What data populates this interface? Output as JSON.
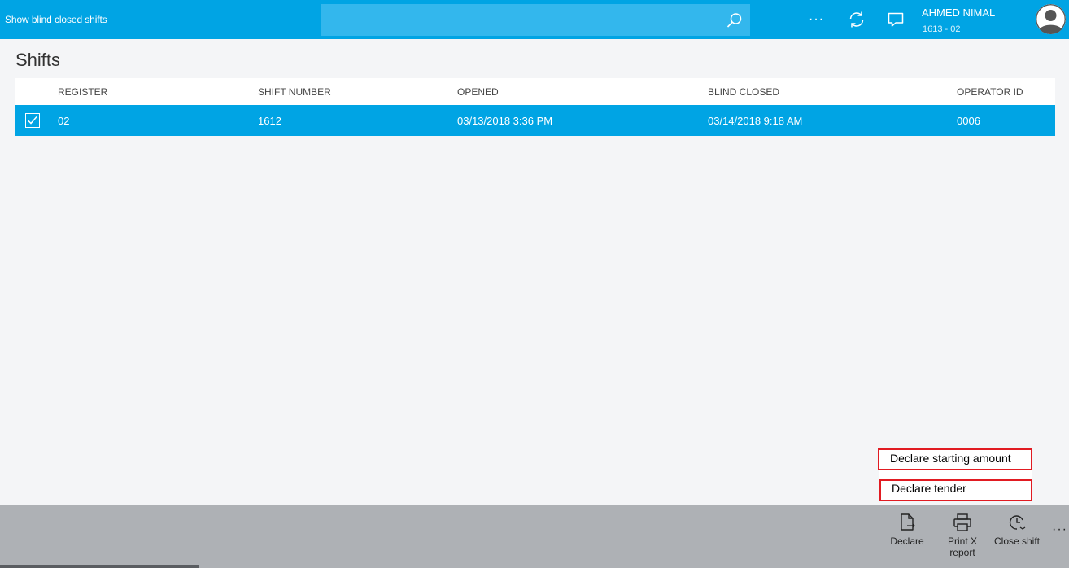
{
  "topbar": {
    "title": "Show blind closed shifts",
    "search_placeholder": "",
    "user": {
      "name": "AHMED NIMAL",
      "subtitle": "1613 - 02"
    },
    "accent_color": "#00a4e4"
  },
  "page": {
    "title": "Shifts"
  },
  "table": {
    "columns": [
      "REGISTER",
      "SHIFT NUMBER",
      "OPENED",
      "BLIND CLOSED",
      "OPERATOR ID"
    ],
    "rows": [
      {
        "selected": true,
        "register": "02",
        "shift_number": "1612",
        "opened": "03/13/2018 3:36 PM",
        "blind_closed": "03/14/2018 9:18 AM",
        "operator_id": "0006"
      }
    ]
  },
  "popup_menu": {
    "items": [
      "Declare starting amount",
      "Declare tender"
    ],
    "highlight_color": "#e11b22"
  },
  "appbar": {
    "buttons": [
      {
        "label": "Declare",
        "icon": "declare-icon"
      },
      {
        "label": "Print X\nreport",
        "label_line1": "Print X",
        "label_line2": "report",
        "icon": "printer-icon"
      },
      {
        "label": "Close shift",
        "icon": "clock-icon"
      }
    ]
  }
}
